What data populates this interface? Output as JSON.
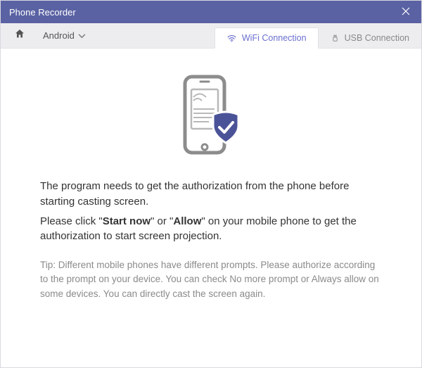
{
  "titlebar": {
    "title": "Phone Recorder"
  },
  "toolbar": {
    "device_selected": "Android"
  },
  "tabs": {
    "wifi": "WiFi Connection",
    "usb": "USB Connection"
  },
  "content": {
    "line1": "The program needs to get the authorization from the phone before starting casting screen.",
    "line2_pre": "Please click \"",
    "line2_b1": "Start now",
    "line2_mid": "\" or \"",
    "line2_b2": "Allow",
    "line2_post": "\" on your mobile phone to get the authorization to start screen projection.",
    "tip": "Tip: Different mobile phones have different prompts. Please authorize according to the prompt on your device. You can check No more prompt or Always allow on some devices. You can directly cast the screen again."
  }
}
